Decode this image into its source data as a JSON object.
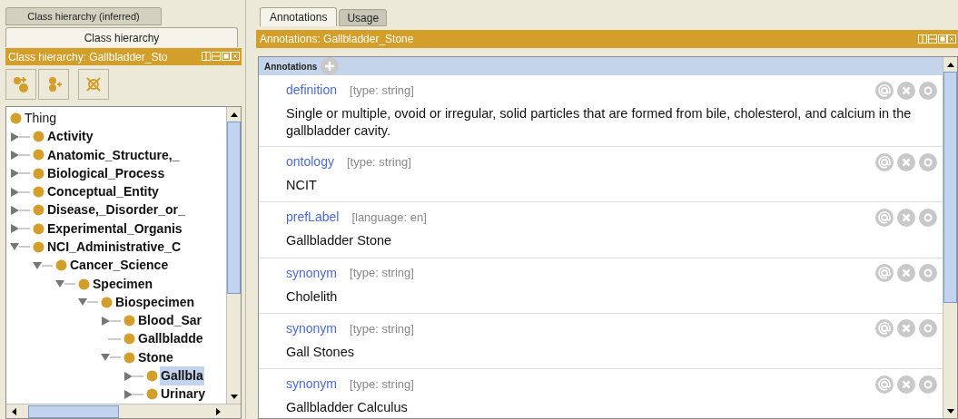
{
  "left_panel": {
    "tabs": [
      {
        "label": "Class hierarchy (inferred)",
        "selected": false
      },
      {
        "label": "Class hierarchy",
        "selected": true
      }
    ],
    "title": "Class hierarchy: Gallbladder_Sto",
    "tree": [
      {
        "label": "Thing",
        "kind": "root",
        "selected": false,
        "children": [
          {
            "label": "Activity",
            "kind": "branch",
            "expanded": false,
            "selected": false
          },
          {
            "label": "Anatomic_Structure,_",
            "kind": "branch",
            "expanded": false,
            "selected": false
          },
          {
            "label": "Biological_Process",
            "kind": "branch",
            "expanded": false,
            "selected": false
          },
          {
            "label": "Conceptual_Entity",
            "kind": "branch",
            "expanded": false,
            "selected": false
          },
          {
            "label": "Disease,_Disorder_or_",
            "kind": "branch",
            "expanded": false,
            "selected": false
          },
          {
            "label": "Experimental_Organis",
            "kind": "branch",
            "expanded": false,
            "selected": false
          },
          {
            "label": "NCI_Administrative_C",
            "kind": "branch",
            "expanded": true,
            "selected": false,
            "children": [
              {
                "label": "Cancer_Science",
                "kind": "branch",
                "expanded": true,
                "selected": false,
                "children": [
                  {
                    "label": "Specimen",
                    "kind": "branch",
                    "expanded": true,
                    "selected": false,
                    "children": [
                      {
                        "label": "Biospecimen",
                        "kind": "branch",
                        "expanded": true,
                        "selected": false,
                        "children": [
                          {
                            "label": "Blood_Sar",
                            "kind": "branch",
                            "expanded": false,
                            "selected": false
                          },
                          {
                            "label": "Gallbladde",
                            "kind": "leaf",
                            "selected": false
                          },
                          {
                            "label": "Stone",
                            "kind": "branch",
                            "expanded": true,
                            "selected": false,
                            "children": [
                              {
                                "label": "Gallbla",
                                "kind": "branch",
                                "expanded": false,
                                "selected": true
                              },
                              {
                                "label": "Urinary",
                                "kind": "branch",
                                "expanded": false,
                                "selected": false
                              }
                            ]
                          }
                        ]
                      }
                    ]
                  }
                ]
              }
            ]
          }
        ]
      }
    ]
  },
  "right_panel": {
    "tabs": [
      {
        "label": "Annotations",
        "selected": true
      },
      {
        "label": "Usage",
        "selected": false
      }
    ],
    "title": "Annotations: Gallbladder_Stone",
    "section_label": "Annotations",
    "annotations": [
      {
        "property": "definition",
        "type": "[type: string]",
        "value": "Single or multiple, ovoid or irregular, solid particles that are formed from bile, cholesterol, and calcium in the gallbladder cavity."
      },
      {
        "property": "ontology",
        "type": "[type: string]",
        "value": "NCIT"
      },
      {
        "property": "prefLabel",
        "type": "[language: en]",
        "value": "Gallbladder Stone"
      },
      {
        "property": "synonym",
        "type": "[type: string]",
        "value": "Cholelith"
      },
      {
        "property": "synonym",
        "type": "[type: string]",
        "value": "Gall Stones"
      },
      {
        "property": "synonym",
        "type": "[type: string]",
        "value": "Gallbladder Calculus"
      }
    ]
  }
}
